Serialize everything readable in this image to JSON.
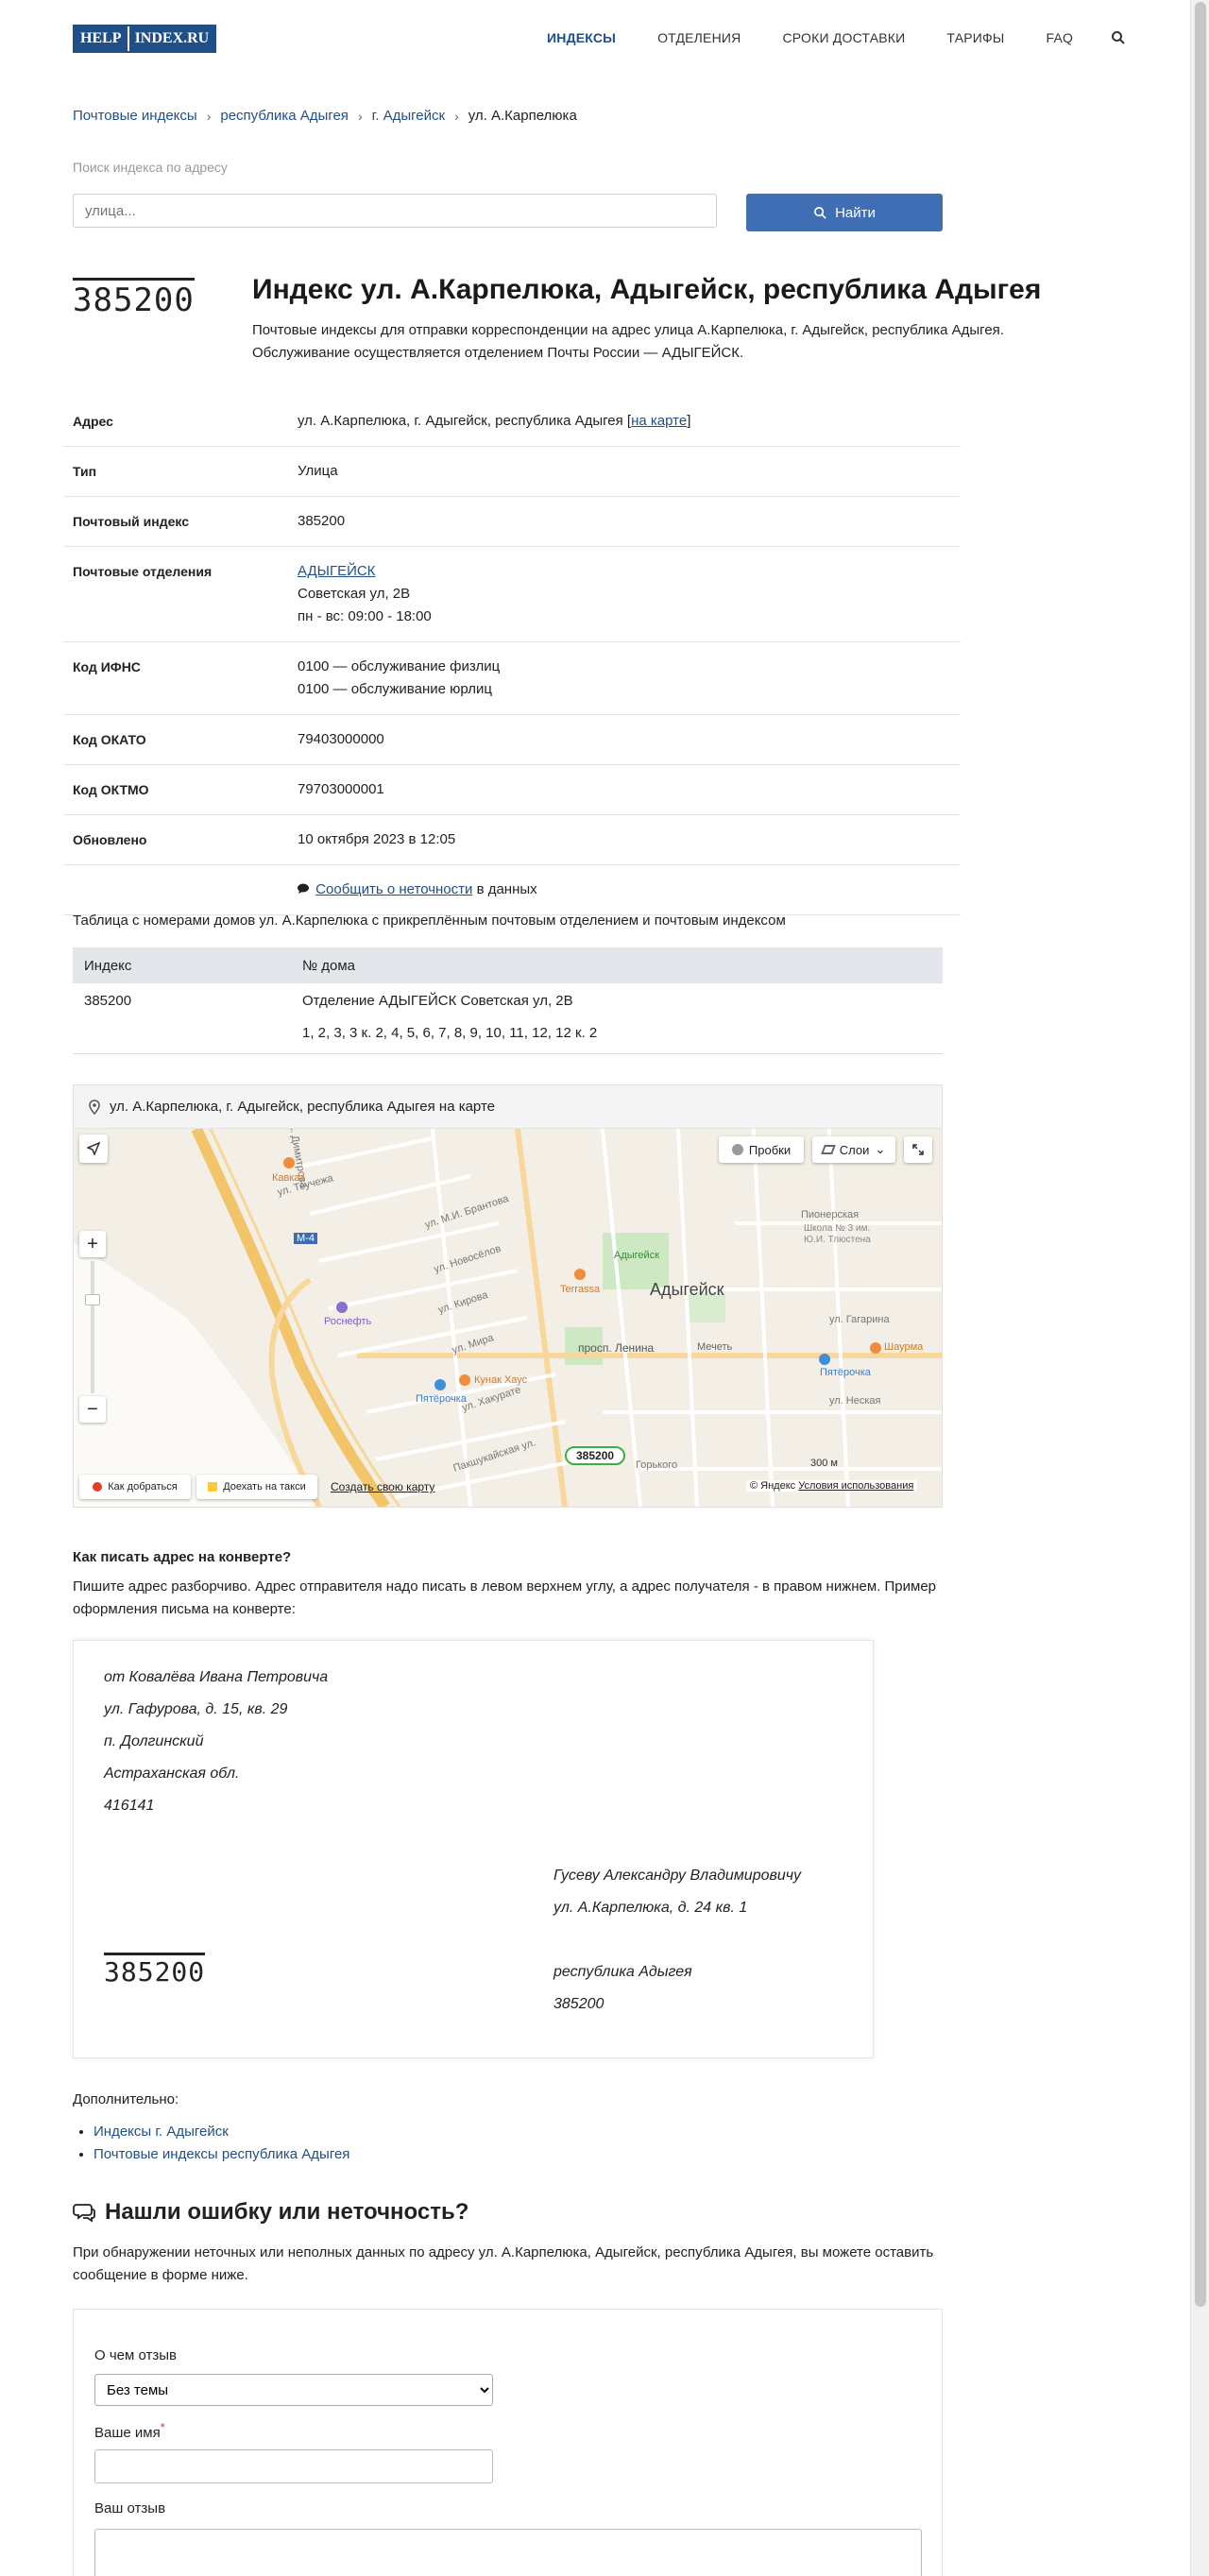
{
  "header": {
    "logo": [
      "HELP",
      "INDEX.RU"
    ],
    "nav": [
      "ИНДЕКСЫ",
      "ОТДЕЛЕНИЯ",
      "СРОКИ ДОСТАВКИ",
      "ТАРИФЫ",
      "FAQ"
    ]
  },
  "breadcrumb": [
    "Почтовые индексы",
    "республика Адыгея",
    "г. Адыгейск",
    "ул. А.Карпелюка"
  ],
  "search": {
    "label": "Поиск индекса по адресу",
    "placeholder": "улица...",
    "button": "Найти"
  },
  "postcode": "385200",
  "page_title": "Индекс ул. А.Карпелюка, Адыгейск, республика Адыгея",
  "intro": "Почтовые индексы для отправки корреспонденции на адрес улица А.Карпелюка, г. Адыгейск, республика Адыгея. Обслуживание осуществляется отделением Почты России — АДЫГЕЙСК.",
  "info": {
    "address_label": "Адрес",
    "address_value": "ул. А.Карпелюка, г. Адыгейск, республика Адыгея",
    "map_link": "на карте",
    "type_label": "Тип",
    "type_value": "Улица",
    "index_label": "Почтовый индекс",
    "index_value": "385200",
    "offices_label": "Почтовые отделения",
    "office_name": "АДЫГЕЙСК",
    "office_address": "Советская ул, 2В",
    "office_hours": "пн - вс: 09:00 - 18:00",
    "ifns_label": "Код ИФНС",
    "ifns_1": "0100 — обслуживание физлиц",
    "ifns_2": "0100 — обслуживание юрлиц",
    "okato_label": "Код ОКАТО",
    "okato_value": "79403000000",
    "oktmo_label": "Код ОКТМО",
    "oktmo_value": "79703000001",
    "updated_label": "Обновлено",
    "updated_value": "10 октября 2023 в 12:05",
    "report_link": "Сообщить о неточности",
    "report_suffix": " в данных"
  },
  "houses": {
    "caption": "Таблица с номерами домов ул. А.Карпелюка с прикреплённым почтовым отделением и почтовым индексом",
    "col_index": "Индекс",
    "col_house": "№ дома",
    "row_index": "385200",
    "row_office": "Отделение АДЫГЕЙСК  Советская ул, 2В",
    "row_numbers": "1, 2, 3, 3 к. 2, 4, 5, 6, 7, 8, 9, 10, 11, 12, 12 к. 2"
  },
  "map": {
    "heading": "ул. А.Карпелюка, г. Адыгейск, республика Адыгея на карте",
    "city": "Адыгейск",
    "traffic": "Пробки",
    "layers": "Слои",
    "route": "Как добраться",
    "taxi": "Доехать на такси",
    "create": "Создать свою карту",
    "copyright": "© Яндекс",
    "terms": "Условия использования",
    "scale": "300 м",
    "marker": "385200",
    "labels": [
      "Кавказ",
      "ул. Димитрова",
      "Пионерская",
      "ул. Теучежа",
      "ул. М.И. Брантова",
      "ул. Новосёлов",
      "Адыгейск",
      "ул. Кирова",
      "Terrassa",
      "ул. Мира",
      "Школа № 3 им. Ю.И. Тлюстена",
      "Роснефть",
      "Кунак Хаус",
      "Пятёрочка",
      "просп. Ленина",
      "Мечеть",
      "Пятёрочка",
      "Шаурма",
      "ул. Хакурате",
      "ул. Неская",
      "Пакшукайская ул.",
      "М-4",
      "ул. Гагарина",
      "Горького"
    ]
  },
  "envelope": {
    "question": "Как писать адрес на конверте?",
    "text": "Пишите адрес разборчиво. Адрес отправителя надо писать в левом верхнем углу, а адрес получателя - в правом нижнем. Пример оформления письма на конверте:",
    "sender": [
      "от Ковалёва Ивана Петровича",
      "ул. Гафурова, д. 15, кв. 29",
      "п. Долгинский",
      "Астраханская обл.",
      "416141"
    ],
    "recipient": [
      "Гусеву Александру Владимировичу",
      "ул. А.Карпелюка, д. 24 кв. 1",
      "",
      "республика Адыгея",
      "385200"
    ]
  },
  "more": {
    "title": "Дополнительно:",
    "links": [
      "Индексы г. Адыгейск",
      "Почтовые индексы республика Адыгея"
    ]
  },
  "feedback": {
    "title": "Нашли ошибку или неточность?",
    "text": "При обнаружении неточных или неполных данных по адресу ул. А.Карпелюка, Адыгейск, республика Адыгея, вы можете оставить сообщение в форме ниже.",
    "topic_label": "О чем отзыв",
    "topic_value": "Без темы",
    "name_label": "Ваше имя",
    "required": "*",
    "review_label": "Ваш отзыв"
  }
}
